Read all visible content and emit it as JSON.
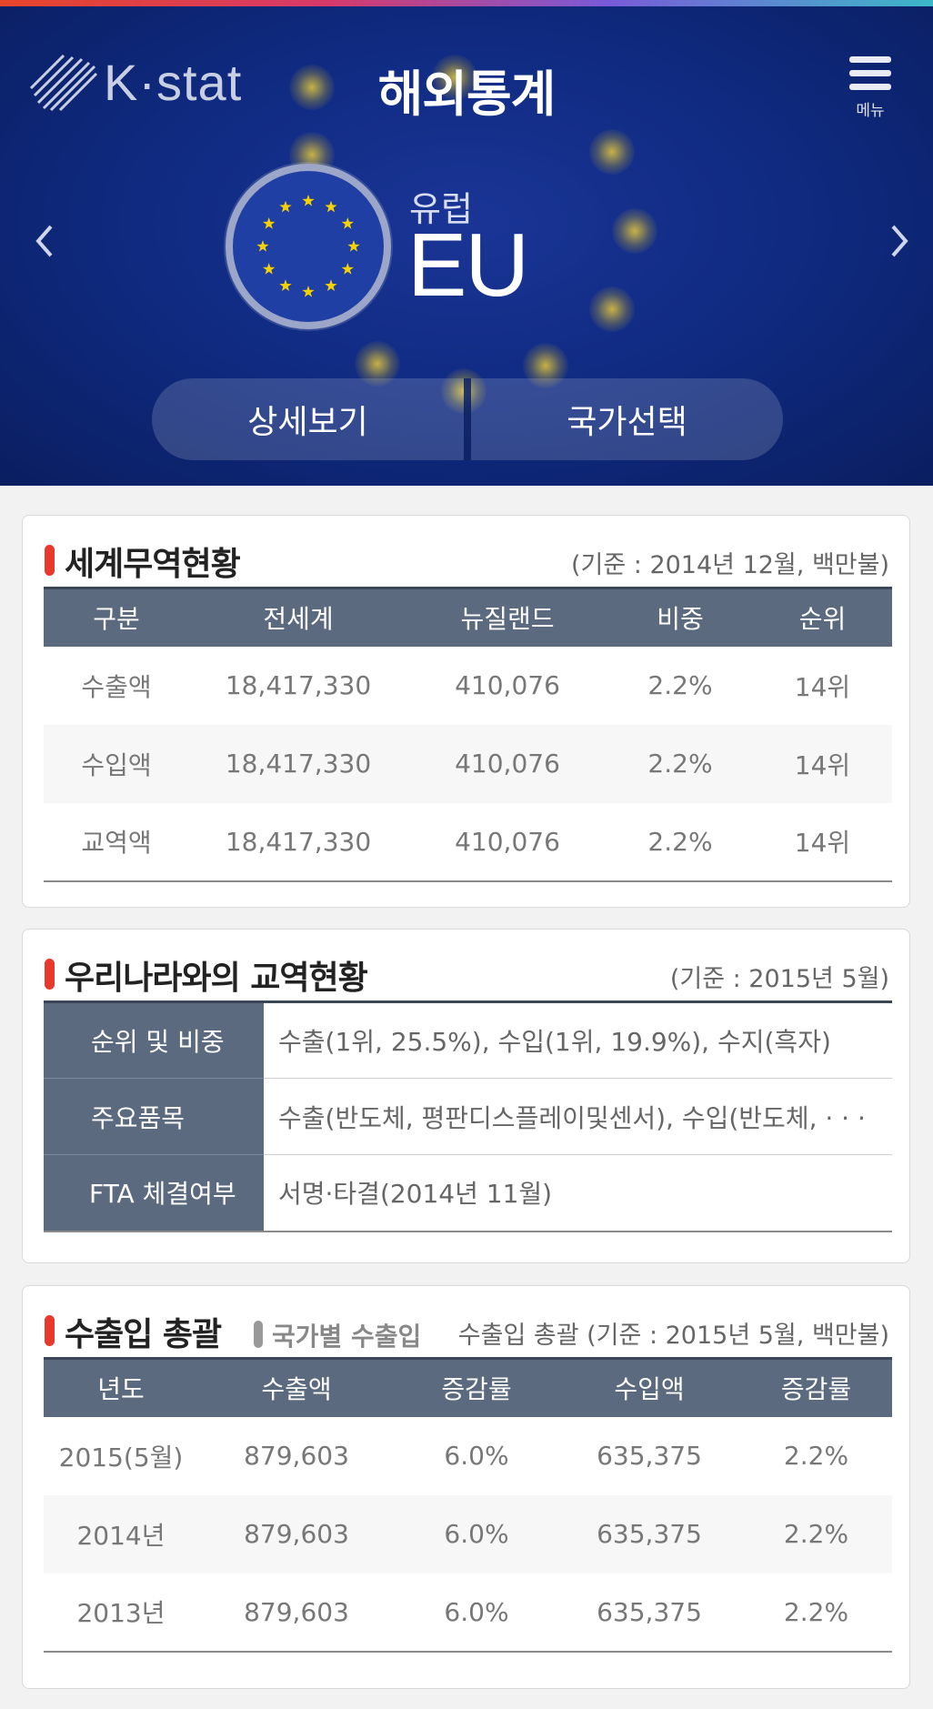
{
  "header": {
    "logo_text": "K·stat",
    "title": "해외통계",
    "menu_label": "메뉴"
  },
  "region": {
    "subtitle": "유럽",
    "name": "EU"
  },
  "hero_buttons": {
    "detail": "상세보기",
    "select_country": "국가선택"
  },
  "world_trade": {
    "title": "세계무역현황",
    "note": "(기준 : 2014년 12월, 백만불)",
    "headers": [
      "구분",
      "전세계",
      "뉴질랜드",
      "비중",
      "순위"
    ],
    "rows": [
      [
        "수출액",
        "18,417,330",
        "410,076",
        "2.2%",
        "14위"
      ],
      [
        "수입액",
        "18,417,330",
        "410,076",
        "2.2%",
        "14위"
      ],
      [
        "교역액",
        "18,417,330",
        "410,076",
        "2.2%",
        "14위"
      ]
    ]
  },
  "korea_trade": {
    "title": "우리나라와의 교역현황",
    "note": "(기준 : 2015년 5월)",
    "rows": [
      {
        "key": "순위 및 비중",
        "value": "수출(1위, 25.5%), 수입(1위, 19.9%), 수지(흑자)"
      },
      {
        "key": "주요품목",
        "value": "수출(반도체, 평판디스플레이및센서), 수입(반도체, · · ·"
      },
      {
        "key": "FTA 체결여부",
        "value": "서명·타결(2014년 11월)"
      }
    ]
  },
  "import_export": {
    "title": "수출입 총괄",
    "tab_by_country": "국가별 수출입",
    "note": "수출입 총괄 (기준 : 2015년 5월, 백만불)",
    "headers": [
      "년도",
      "수출액",
      "증감률",
      "수입액",
      "증감률"
    ],
    "rows": [
      [
        "2015(5월)",
        "879,603",
        "6.0%",
        "635,375",
        "2.2%"
      ],
      [
        "2014년",
        "879,603",
        "6.0%",
        "635,375",
        "2.2%"
      ],
      [
        "2013년",
        "879,603",
        "6.0%",
        "635,375",
        "2.2%"
      ]
    ]
  },
  "colors": {
    "hero_bg": "#0f2a80",
    "accent_red": "#e8392c",
    "table_header": "#5b6a7e",
    "eu_star": "#f5d100"
  }
}
